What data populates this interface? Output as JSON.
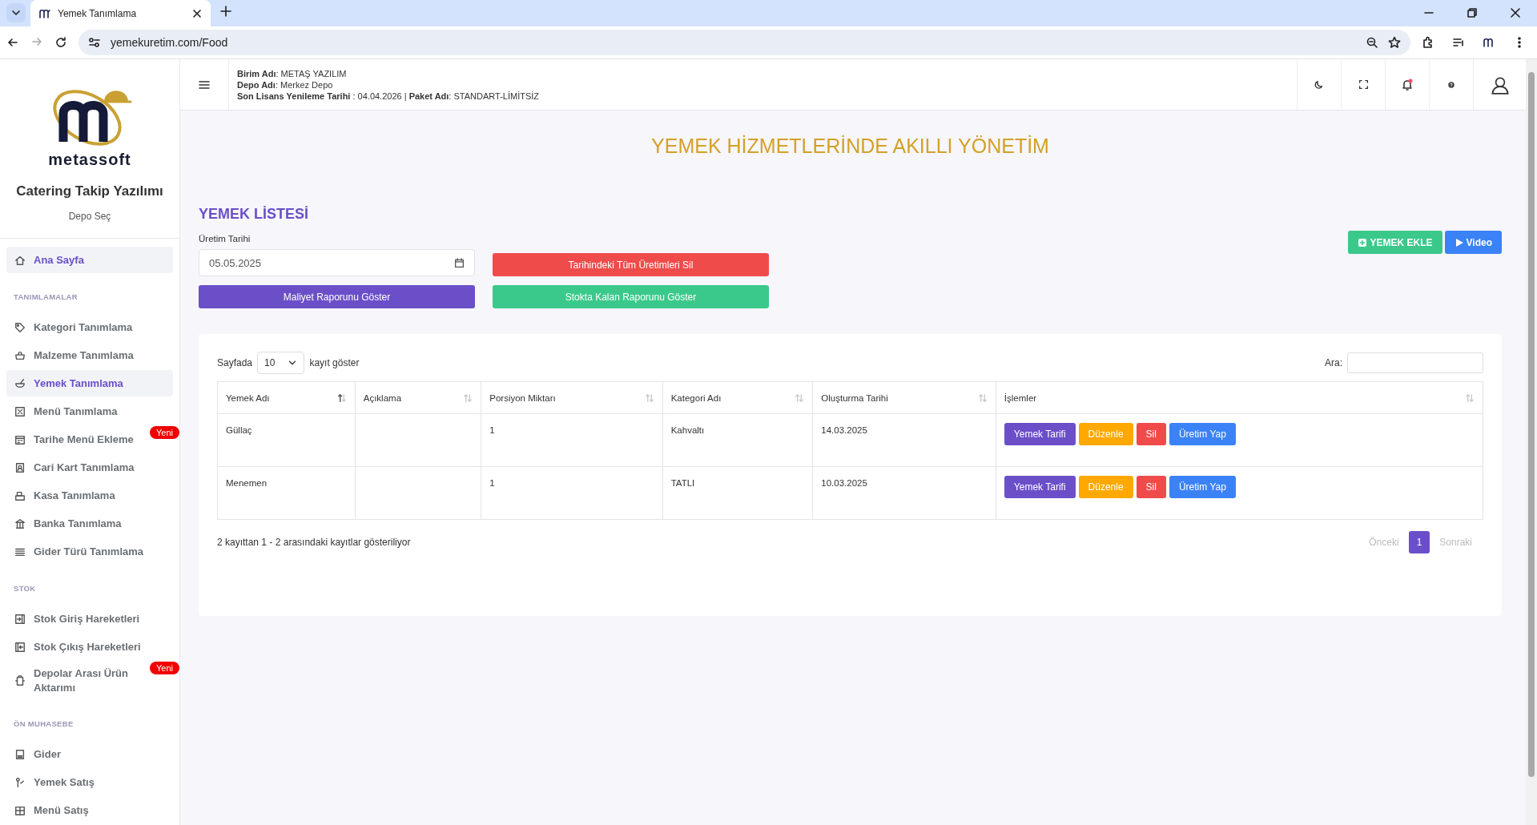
{
  "browser": {
    "tab_title": "Yemek Tanımlama",
    "url": "yemekuretim.com/Food"
  },
  "sidebar": {
    "brand": "metassoft",
    "app_title": "Catering Takip Yazılımı",
    "depot_link": "Depo Seç",
    "items": [
      {
        "kind": "link",
        "label": "Ana Sayfa",
        "selected": true
      },
      {
        "kind": "section",
        "label": "TANIMLAMALAR"
      },
      {
        "kind": "link",
        "label": "Kategori Tanımlama",
        "selected": false
      },
      {
        "kind": "link",
        "label": "Malzeme Tanımlama",
        "selected": false
      },
      {
        "kind": "link",
        "label": "Yemek Tanımlama",
        "selected": true
      },
      {
        "kind": "link",
        "label": "Menü Tanımlama",
        "selected": false
      },
      {
        "kind": "link",
        "label": "Tarihe Menü Ekleme",
        "selected": false,
        "badge": "Yeni"
      },
      {
        "kind": "link",
        "label": "Cari Kart Tanımlama",
        "selected": false
      },
      {
        "kind": "link",
        "label": "Kasa Tanımlama",
        "selected": false
      },
      {
        "kind": "link",
        "label": "Banka Tanımlama",
        "selected": false
      },
      {
        "kind": "link",
        "label": "Gider Türü Tanımlama",
        "selected": false
      },
      {
        "kind": "section",
        "label": "STOK"
      },
      {
        "kind": "link",
        "label": "Stok Giriş Hareketleri",
        "selected": false
      },
      {
        "kind": "link",
        "label": "Stok Çıkış Hareketleri",
        "selected": false
      },
      {
        "kind": "link",
        "label": "Depolar Arası Ürün Aktarımı",
        "selected": false,
        "badge": "Yeni"
      },
      {
        "kind": "section",
        "label": "ÖN MUHASEBE"
      },
      {
        "kind": "link",
        "label": "Gider",
        "selected": false
      },
      {
        "kind": "link",
        "label": "Yemek Satış",
        "selected": false
      },
      {
        "kind": "link",
        "label": "Menü Satış",
        "selected": false
      }
    ]
  },
  "header": {
    "info_lines": [
      "**Birim Adı**: METAŞ YAZILIM",
      "**Depo Adı**: Merkez Depo",
      "**Son Lisans Yenileme Tarihi** : 04.04.2026 | **Paket Adı**: STANDART-LİMİTSİZ"
    ]
  },
  "main": {
    "banner": "YEMEK HİZMETLERİNDE AKILLI YÖNETİM",
    "list_title": "YEMEK LİSTESİ",
    "date_label": "Üretim Tarihi",
    "date_value": "05.05.2025",
    "actions": [
      {
        "label": "Tarihindeki Tüm Üretimleri Sil",
        "color": "#ef4b4b"
      },
      {
        "label": "Maliyet Raporunu Göster",
        "color": "#6a4fc9"
      },
      {
        "label": "Stokta Kalan Raporunu Göster",
        "color": "#3ac98a"
      }
    ],
    "top_buttons": [
      {
        "label": "YEMEK EKLE",
        "color": "#3ac98a",
        "kind": "add"
      },
      {
        "label": "Video",
        "color": "#3b82f6",
        "kind": "play"
      }
    ],
    "table": {
      "length_prefix": "Sayfada",
      "length_value": "10",
      "length_suffix": "kayıt göster",
      "search_label": "Ara:",
      "columns": [
        "Yemek Adı",
        "Açıklama",
        "Porsiyon Miktarı",
        "Kategori Adı",
        "Oluşturma Tarihi",
        "İşlemler"
      ],
      "rows": [
        {
          "cells": [
            "Güllaç",
            "",
            "1",
            "Kahvaltı",
            "14.03.2025"
          ],
          "actions": [
            {
              "label": "Yemek Tarifi",
              "color": "#6a4fc9"
            },
            {
              "label": "Düzenle",
              "color": "#ffa800"
            },
            {
              "label": "Sil",
              "color": "#ef4b4b"
            },
            {
              "label": "Üretim Yap",
              "color": "#3b82f6"
            }
          ]
        },
        {
          "cells": [
            "Menemen",
            "",
            "1",
            "TATLI",
            "10.03.2025"
          ],
          "actions": [
            {
              "label": "Yemek Tarifi",
              "color": "#6a4fc9"
            },
            {
              "label": "Düzenle",
              "color": "#ffa800"
            },
            {
              "label": "Sil",
              "color": "#ef4b4b"
            },
            {
              "label": "Üretim Yap",
              "color": "#3b82f6"
            }
          ]
        }
      ],
      "info": "2 kayıttan 1 - 2 arasındaki kayıtlar gösteriliyor",
      "pagination": [
        {
          "label": "Önceki",
          "kind": "prev",
          "disabled": true
        },
        {
          "label": "1",
          "kind": "page",
          "selected": true
        },
        {
          "label": "Sonraki",
          "kind": "next",
          "disabled": true
        }
      ]
    }
  }
}
